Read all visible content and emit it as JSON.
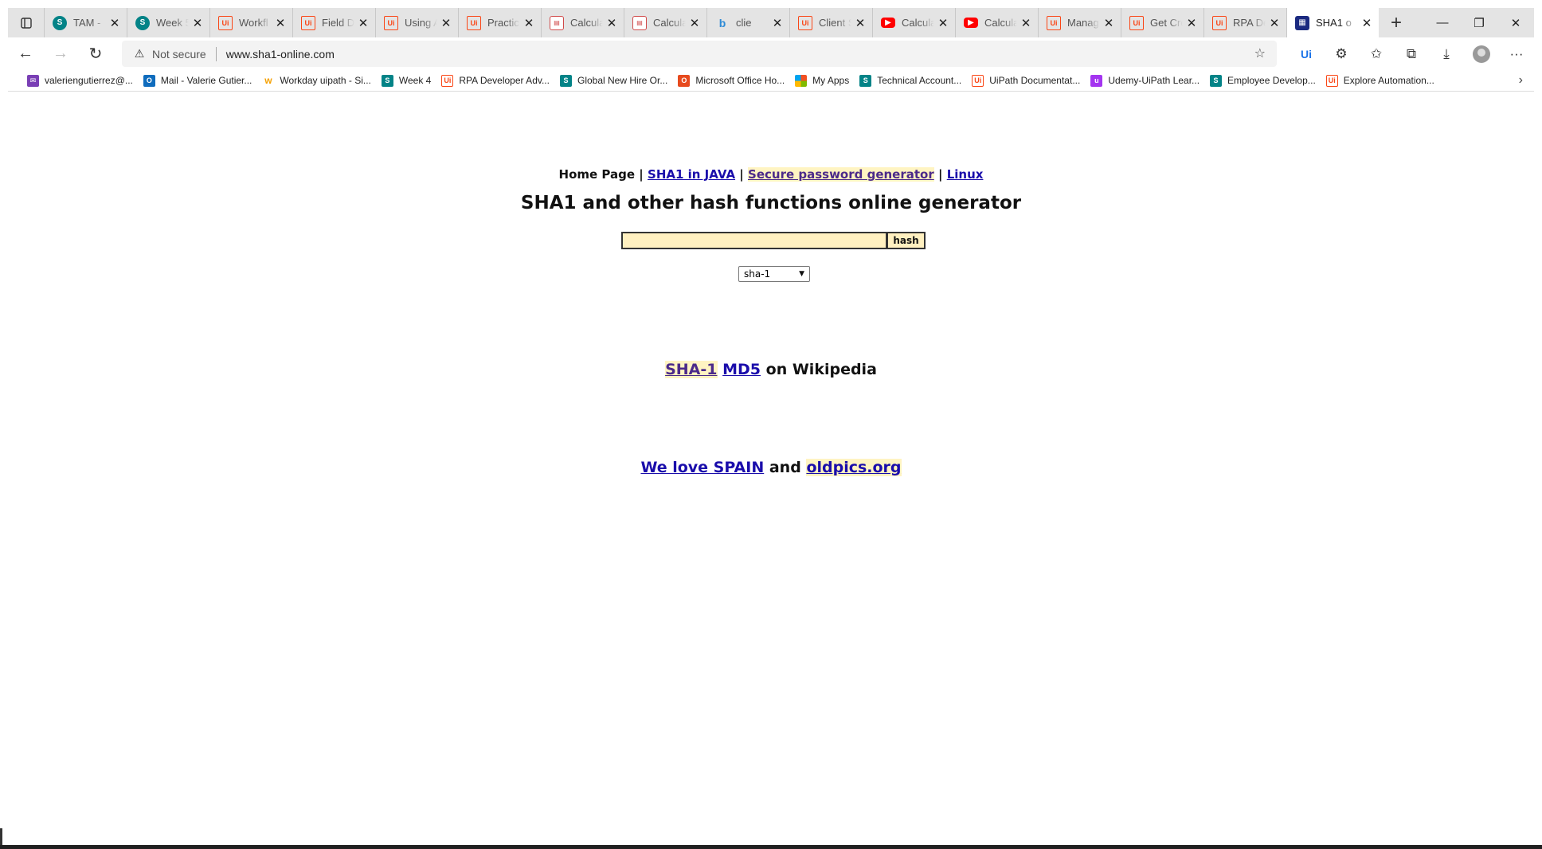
{
  "tabs": [
    {
      "title": "TAM - ",
      "favicon": "sharepoint-icon"
    },
    {
      "title": "Week 5",
      "favicon": "sharepoint-icon"
    },
    {
      "title": "Workfl",
      "favicon": "uipath-icon"
    },
    {
      "title": "Field D",
      "favicon": "uipath-icon"
    },
    {
      "title": "Using A",
      "favicon": "uipath-icon"
    },
    {
      "title": "Practic",
      "favicon": "uipath-icon"
    },
    {
      "title": "Calcula",
      "favicon": "pdf-icon"
    },
    {
      "title": "Calcula",
      "favicon": "pdf-icon"
    },
    {
      "title": "clie",
      "favicon": "bing-icon"
    },
    {
      "title": "Client S",
      "favicon": "uipath-icon"
    },
    {
      "title": "Calcula",
      "favicon": "youtube-icon"
    },
    {
      "title": "Calcula",
      "favicon": "youtube-icon"
    },
    {
      "title": "Manag",
      "favicon": "uipath-icon"
    },
    {
      "title": "Get Cre",
      "favicon": "uipath-icon"
    },
    {
      "title": "RPA De",
      "favicon": "uipath-icon"
    },
    {
      "title": "SHA1 o",
      "favicon": "sha1-site-icon",
      "active": true
    }
  ],
  "address_bar": {
    "security_text": "Not secure",
    "url": "www.sha1-online.com"
  },
  "favorites": [
    {
      "label": "valeriengutierrez@...",
      "icon": "mail-icon"
    },
    {
      "label": "Mail - Valerie Gutier...",
      "icon": "outlook-icon"
    },
    {
      "label": "Workday uipath - Si...",
      "icon": "workday-icon"
    },
    {
      "label": "Week 4",
      "icon": "sharepoint-icon"
    },
    {
      "label": "RPA Developer Adv...",
      "icon": "uipath-icon"
    },
    {
      "label": "Global New Hire Or...",
      "icon": "sharepoint-icon"
    },
    {
      "label": "Microsoft Office Ho...",
      "icon": "office-icon"
    },
    {
      "label": "My Apps",
      "icon": "apps-icon"
    },
    {
      "label": "Technical Account...",
      "icon": "sharepoint-icon"
    },
    {
      "label": "UiPath Documentat...",
      "icon": "uipath-icon"
    },
    {
      "label": "Udemy-UiPath Lear...",
      "icon": "udemy-icon"
    },
    {
      "label": "Employee Develop...",
      "icon": "sharepoint-icon"
    },
    {
      "label": "Explore Automation...",
      "icon": "uipath-icon"
    }
  ],
  "page": {
    "nav": {
      "home": "Home Page",
      "sep1": "|",
      "java": "SHA1 in JAVA",
      "sep2": "|",
      "password": "Secure password generator",
      "sep3": "|",
      "linux": "Linux"
    },
    "title": "SHA1 and other hash functions online generator",
    "hash_input_value": "",
    "hash_button": "hash",
    "algorithm_selected": "sha-1",
    "wiki": {
      "sha1": "SHA-1",
      "md5": "MD5",
      "suffix": "on Wikipedia"
    },
    "footer": {
      "spain": "We love SPAIN",
      "and": "and",
      "oldpics": "oldpics.org"
    }
  }
}
